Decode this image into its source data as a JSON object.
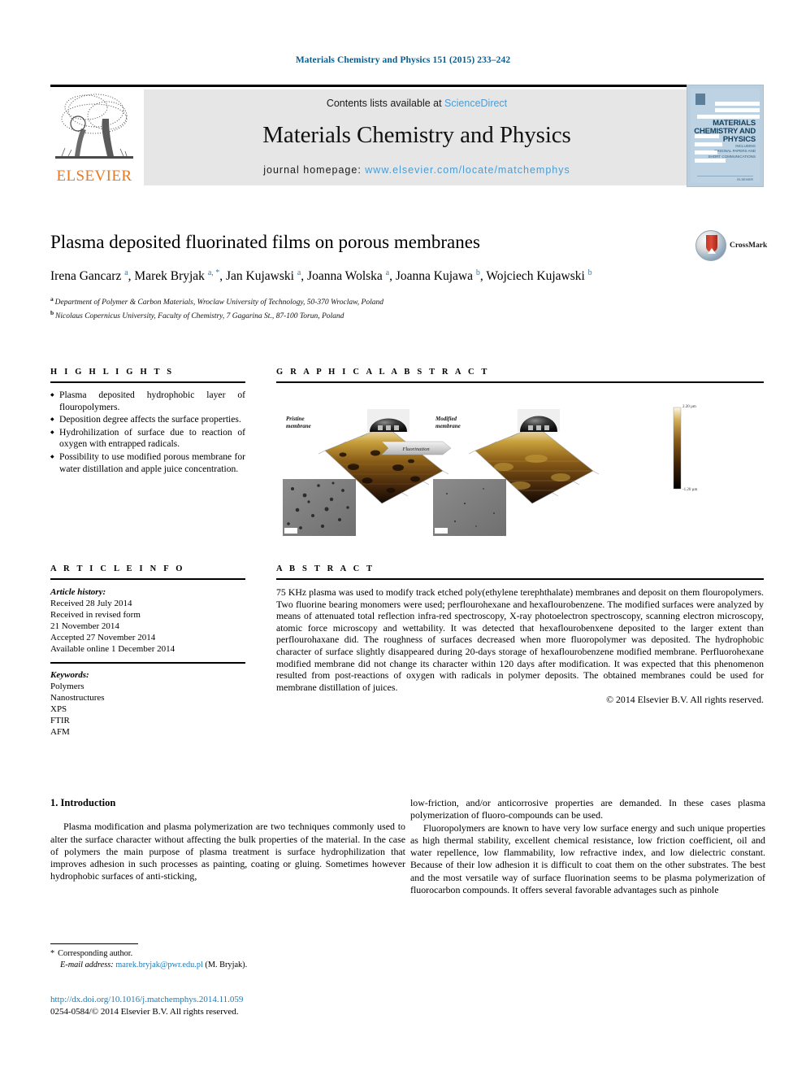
{
  "header": {
    "journal_reference": "Materials Chemistry and Physics 151 (2015) 233–242",
    "contents_prefix": "Contents lists available at ",
    "contents_link": "ScienceDirect",
    "journal_title": "Materials Chemistry and Physics",
    "homepage_label": "journal homepage: ",
    "homepage_url": "www.elsevier.com/locate/matchemphys",
    "publisher_name": "ELSEVIER",
    "cover": {
      "title_line1": "MATERIALS",
      "title_line2": "CHEMISTRY AND",
      "title_line3": "PHYSICS",
      "sub_line1": "INCLUDING",
      "sub_line2": "ORIGINAL PAPERS AND",
      "sub_line3": "SHORT COMMUNICATIONS",
      "foot": "ELSEVIER"
    },
    "colors": {
      "link_blue": "#4b9cd3",
      "ref_blue": "#0b5c8c",
      "elsevier_orange": "#E87722",
      "band_grey": "#e6e6e6"
    }
  },
  "article": {
    "title": "Plasma deposited fluorinated films on porous membranes",
    "authors": [
      {
        "name": "Irena Gancarz",
        "marks": "a"
      },
      {
        "name": "Marek Bryjak",
        "marks": "a, *"
      },
      {
        "name": "Jan Kujawski",
        "marks": "a"
      },
      {
        "name": "Joanna Wolska",
        "marks": "a"
      },
      {
        "name": "Joanna Kujawa",
        "marks": "b"
      },
      {
        "name": "Wojciech Kujawski",
        "marks": "b"
      }
    ],
    "affiliations": [
      {
        "mark": "a",
        "text": "Department of Polymer & Carbon Materials, Wroclaw University of Technology, 50-370 Wroclaw, Poland"
      },
      {
        "mark": "b",
        "text": "Nicolaus Copernicus University, Faculty of Chemistry, 7 Gagarina St., 87-100 Torun, Poland"
      }
    ],
    "crossmark_label": "CrossMark"
  },
  "highlights": {
    "heading": "H I G H L I G H T S",
    "items": [
      "Plasma deposited hydrophobic layer of flouropolymers.",
      "Deposition degree affects the surface properties.",
      "Hydrohilization of surface due to reaction of oxygen with entrapped radicals.",
      "Possibility to use modified porous membrane for water distillation and apple juice concentration."
    ]
  },
  "graphical_abstract": {
    "heading": "G R A P H I C A L   A B S T R A C T",
    "label_left_line1": "Pristine",
    "label_left_line2": "membrane",
    "label_right_line1": "Modified",
    "label_right_line2": "membrane",
    "arrow_label": "Fluorination",
    "colorbar_top": "2.20 µm",
    "colorbar_bottom": "-1.20 µm"
  },
  "article_info": {
    "heading": "A R T I C L E   I N F O",
    "history_title": "Article history:",
    "history": [
      "Received 28 July 2014",
      "Received in revised form",
      "21 November 2014",
      "Accepted 27 November 2014",
      "Available online 1 December 2014"
    ],
    "keywords_title": "Keywords:",
    "keywords": [
      "Polymers",
      "Nanostructures",
      "XPS",
      "FTIR",
      "AFM"
    ]
  },
  "abstract": {
    "heading": "A B S T R A C T",
    "text": "75 KHz plasma was used to modify track etched poly(ethylene terephthalate) membranes and deposit on them flouropolymers. Two fluorine bearing monomers were used; perflourohexane and hexaflourobenzene. The modified surfaces were analyzed by means of attenuated total reflection infra-red spectroscopy, X-ray photoelectron spectroscopy, scanning electron microscopy, atomic force microscopy and wettability. It was detected that hexaflourobenxene deposited to the larger extent than perflourohaxane did. The roughness of surfaces decreased when more fluoropolymer was deposited. The hydrophobic character of surface slightly disappeared during 20-days storage of hexaflourobenzene modified membrane. Perfluorohexane modified membrane did not change its character within 120 days after modification. It was expected that this phenomenon resulted from post-reactions of oxygen with radicals in polymer deposits. The obtained membranes could be used for membrane distillation of juices.",
    "copyright": "© 2014 Elsevier B.V. All rights reserved."
  },
  "body": {
    "section_number_title": "1. Introduction",
    "left_paragraph_1": "Plasma modification and plasma polymerization are two techniques commonly used to alter the surface character without affecting the bulk properties of the material. In the case of polymers the main purpose of plasma treatment is surface hydrophilization that improves adhesion in such processes as painting, coating or gluing. Sometimes however hydrophobic surfaces of anti-sticking,",
    "right_paragraph_1": "low-friction, and/or anticorrosive properties are demanded. In these cases plasma polymerization of fluoro-compounds can be used.",
    "right_paragraph_2": "Fluoropolymers are known to have very low surface energy and such unique properties as high thermal stability, excellent chemical resistance, low friction coefficient, oil and water repellence, low flammability, low refractive index, and low dielectric constant. Because of their low adhesion it is difficult to coat them on the other substrates. The best and the most versatile way of surface fluorination seems to be plasma polymerization of fluorocarbon compounds. It offers several favorable advantages such as pinhole"
  },
  "footer": {
    "corresponding_marker": "*",
    "corresponding_text": "Corresponding author.",
    "email_label": "E-mail address:",
    "email": "marek.bryjak@pwr.edu.pl",
    "email_suffix": "(M. Bryjak).",
    "doi": "http://dx.doi.org/10.1016/j.matchemphys.2014.11.059",
    "issn_line": "0254-0584/© 2014 Elsevier B.V. All rights reserved."
  }
}
